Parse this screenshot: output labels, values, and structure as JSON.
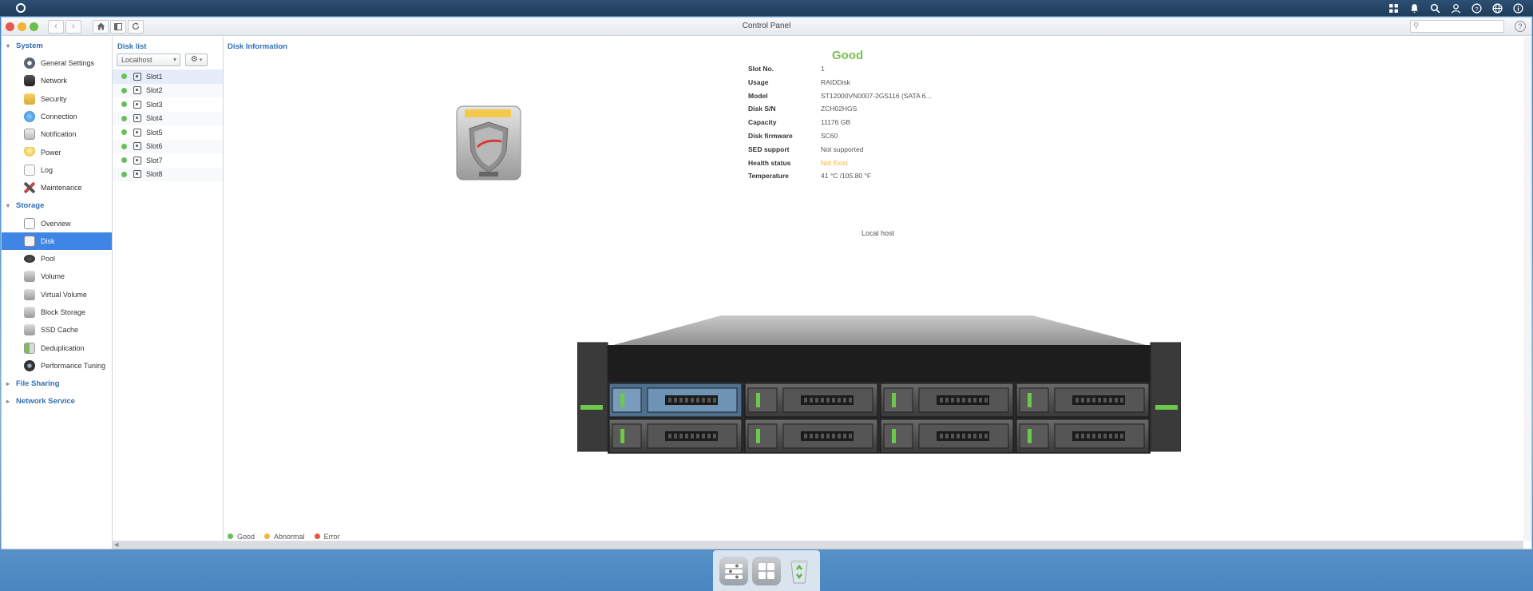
{
  "window": {
    "title": "Control Panel",
    "search_placeholder": "",
    "help": "?"
  },
  "leftnav": {
    "system_label": "System",
    "system_items": [
      {
        "label": "General Settings",
        "icon": "gear-icon"
      },
      {
        "label": "Network",
        "icon": "network-icon"
      },
      {
        "label": "Security",
        "icon": "security-icon"
      },
      {
        "label": "Connection",
        "icon": "connection-icon"
      },
      {
        "label": "Notification",
        "icon": "notification-icon"
      },
      {
        "label": "Power",
        "icon": "power-icon"
      },
      {
        "label": "Log",
        "icon": "log-icon"
      },
      {
        "label": "Maintenance",
        "icon": "maintenance-icon"
      }
    ],
    "storage_label": "Storage",
    "storage_items": [
      {
        "label": "Overview",
        "icon": "overview-icon"
      },
      {
        "label": "Disk",
        "icon": "disk-icon"
      },
      {
        "label": "Pool",
        "icon": "pool-icon"
      },
      {
        "label": "Volume",
        "icon": "volume-icon"
      },
      {
        "label": "Virtual Volume",
        "icon": "virtual-volume-icon"
      },
      {
        "label": "Block Storage",
        "icon": "block-storage-icon"
      },
      {
        "label": "SSD Cache",
        "icon": "ssd-cache-icon"
      },
      {
        "label": "Deduplication",
        "icon": "deduplication-icon"
      },
      {
        "label": "Performance Tuning",
        "icon": "performance-icon"
      }
    ],
    "file_sharing_label": "File Sharing",
    "network_service_label": "Network Service"
  },
  "disklist": {
    "title": "Disk list",
    "host_select": "Localhost",
    "slots": [
      "Slot1",
      "Slot2",
      "Slot3",
      "Slot4",
      "Slot5",
      "Slot6",
      "Slot7",
      "Slot8"
    ]
  },
  "main": {
    "title": "Disk Information",
    "status": "Good",
    "props": [
      {
        "k": "Slot No.",
        "v": "1"
      },
      {
        "k": "Usage",
        "v": "RAIDDisk"
      },
      {
        "k": "Model",
        "v": "ST12000VN0007-2GS116 (SATA 6..."
      },
      {
        "k": "Disk S/N",
        "v": "ZCH02HGS"
      },
      {
        "k": "Capacity",
        "v": "11176 GB"
      },
      {
        "k": "Disk firmware",
        "v": "SC60"
      },
      {
        "k": "SED support",
        "v": "Not supported"
      },
      {
        "k": "Health status",
        "v": "Not Exist"
      },
      {
        "k": "Temperature",
        "v": "41 °C /105.80 °F"
      }
    ],
    "host_label": "Local host",
    "legend": [
      "Good",
      "Abnormal",
      "Error"
    ]
  },
  "colors": {
    "accent": "#3d86e6",
    "good": "#66c05a",
    "abnormal": "#f4b33a",
    "error": "#e8573c"
  }
}
